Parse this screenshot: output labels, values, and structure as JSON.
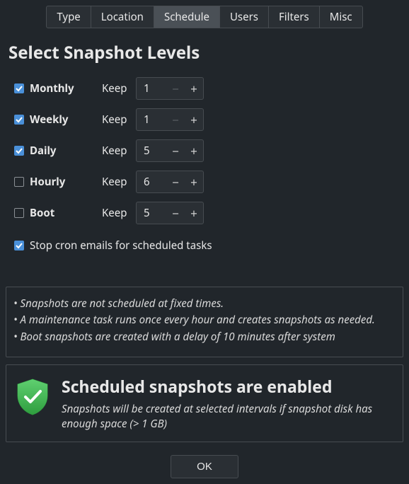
{
  "tabs": [
    {
      "label": "Type",
      "active": false
    },
    {
      "label": "Location",
      "active": false
    },
    {
      "label": "Schedule",
      "active": true
    },
    {
      "label": "Users",
      "active": false
    },
    {
      "label": "Filters",
      "active": false
    },
    {
      "label": "Misc",
      "active": false
    }
  ],
  "title": "Select Snapshot Levels",
  "keep_label": "Keep",
  "levels": [
    {
      "name": "Monthly",
      "checked": true,
      "keep": "1",
      "minus_dim": true
    },
    {
      "name": "Weekly",
      "checked": true,
      "keep": "1",
      "minus_dim": true
    },
    {
      "name": "Daily",
      "checked": true,
      "keep": "5",
      "minus_dim": false
    },
    {
      "name": "Hourly",
      "checked": false,
      "keep": "6",
      "minus_dim": false
    },
    {
      "name": "Boot",
      "checked": false,
      "keep": "5",
      "minus_dim": false
    }
  ],
  "cron": {
    "checked": true,
    "label": "Stop cron emails for scheduled tasks"
  },
  "info": {
    "l1": "• Snapshots are not scheduled at fixed times.",
    "l2": "• A maintenance task runs once every hour and creates snapshots as needed.",
    "l3": "• Boot snapshots are created with a delay of 10 minutes after system"
  },
  "status": {
    "title": "Scheduled snapshots are enabled",
    "body": "Snapshots will be created at selected intervals if snapshot disk has enough space (> 1 GB)"
  },
  "ok_label": "OK"
}
